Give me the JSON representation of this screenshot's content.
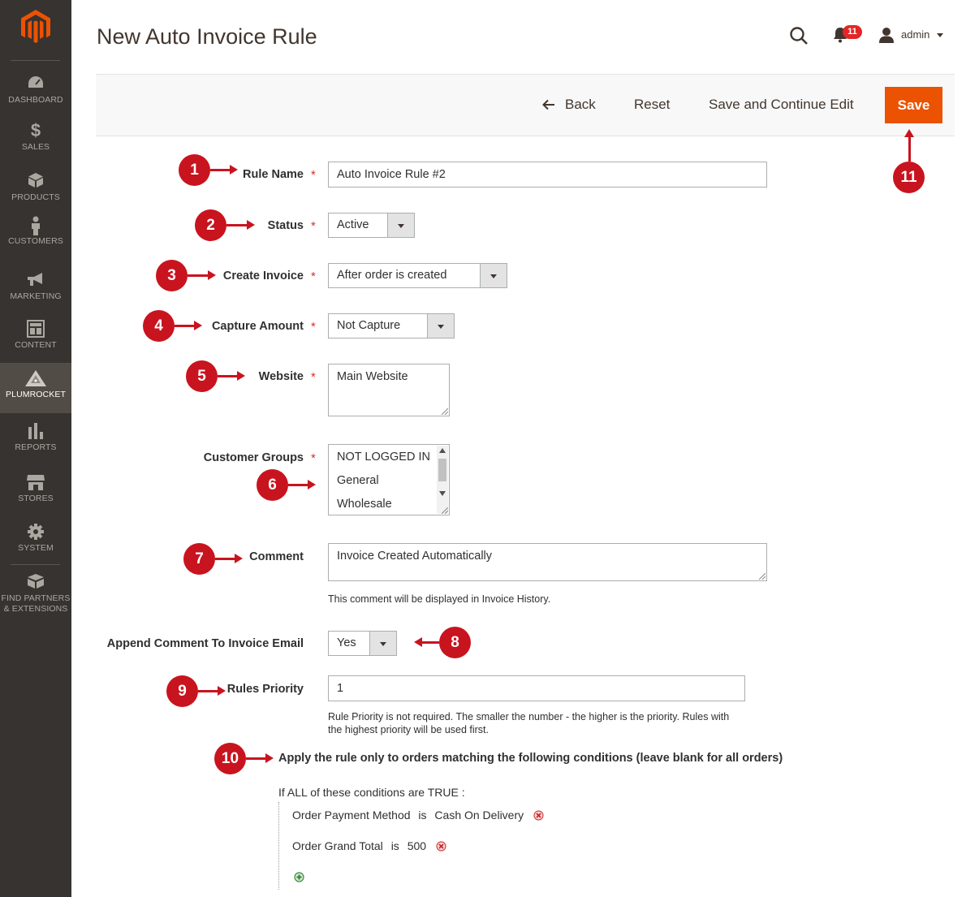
{
  "sidebar": {
    "items": [
      {
        "label": "DASHBOARD",
        "icon": "dashboard-icon"
      },
      {
        "label": "SALES",
        "icon": "dollar-icon"
      },
      {
        "label": "PRODUCTS",
        "icon": "cube-icon"
      },
      {
        "label": "CUSTOMERS",
        "icon": "person-icon"
      },
      {
        "label": "MARKETING",
        "icon": "megaphone-icon"
      },
      {
        "label": "CONTENT",
        "icon": "layout-icon"
      },
      {
        "label": "PLUMROCKET",
        "icon": "plumrocket-icon"
      },
      {
        "label": "REPORTS",
        "icon": "bar-chart-icon"
      },
      {
        "label": "STORES",
        "icon": "store-icon"
      },
      {
        "label": "SYSTEM",
        "icon": "gear-icon"
      },
      {
        "label_line1": "FIND PARTNERS",
        "label_line2": "& EXTENSIONS",
        "icon": "box-icon"
      }
    ],
    "active": "PLUMROCKET"
  },
  "header": {
    "title": "New Auto Invoice Rule",
    "notification_count": "11",
    "username": "admin"
  },
  "actions": {
    "back": "Back",
    "reset": "Reset",
    "save_continue": "Save and Continue Edit",
    "save": "Save"
  },
  "form": {
    "rule_name": {
      "label": "Rule Name",
      "value": "Auto Invoice Rule #2"
    },
    "status": {
      "label": "Status",
      "value": "Active"
    },
    "create_invoice": {
      "label": "Create Invoice",
      "value": "After order is created"
    },
    "capture_amount": {
      "label": "Capture Amount",
      "value": "Not Capture"
    },
    "website": {
      "label": "Website",
      "value": "Main Website"
    },
    "customer_groups": {
      "label": "Customer Groups",
      "options": [
        "NOT LOGGED IN",
        "General",
        "Wholesale"
      ]
    },
    "comment": {
      "label": "Comment",
      "value": "Invoice Created Automatically",
      "note": "This comment will be displayed in Invoice History."
    },
    "append_comment": {
      "label": "Append Comment To Invoice Email",
      "value": "Yes"
    },
    "rules_priority": {
      "label": "Rules Priority",
      "value": "1",
      "note_line1": "Rule Priority is not required. The smaller the number - the higher is the priority. Rules with",
      "note_line2": "the highest priority will be used first."
    }
  },
  "conditions": {
    "heading": "Apply the rule only to orders matching the following conditions (leave blank for all orders)",
    "root": {
      "if": "If",
      "aggregator": "ALL",
      "middle": "of these conditions are",
      "value": "TRUE",
      "suffix": ":"
    },
    "items": [
      {
        "attribute": "Order Payment Method",
        "operator": "is",
        "value": "Cash On Delivery"
      },
      {
        "attribute": "Order Grand Total",
        "operator": "is",
        "value": "500"
      }
    ]
  },
  "markers": [
    "1",
    "2",
    "3",
    "4",
    "5",
    "6",
    "7",
    "8",
    "9",
    "10",
    "11"
  ],
  "colors": {
    "sidebar_bg": "#373330",
    "accent_orange": "#eb5202",
    "marker_red": "#c8141e",
    "required_star": "#e02b27"
  }
}
